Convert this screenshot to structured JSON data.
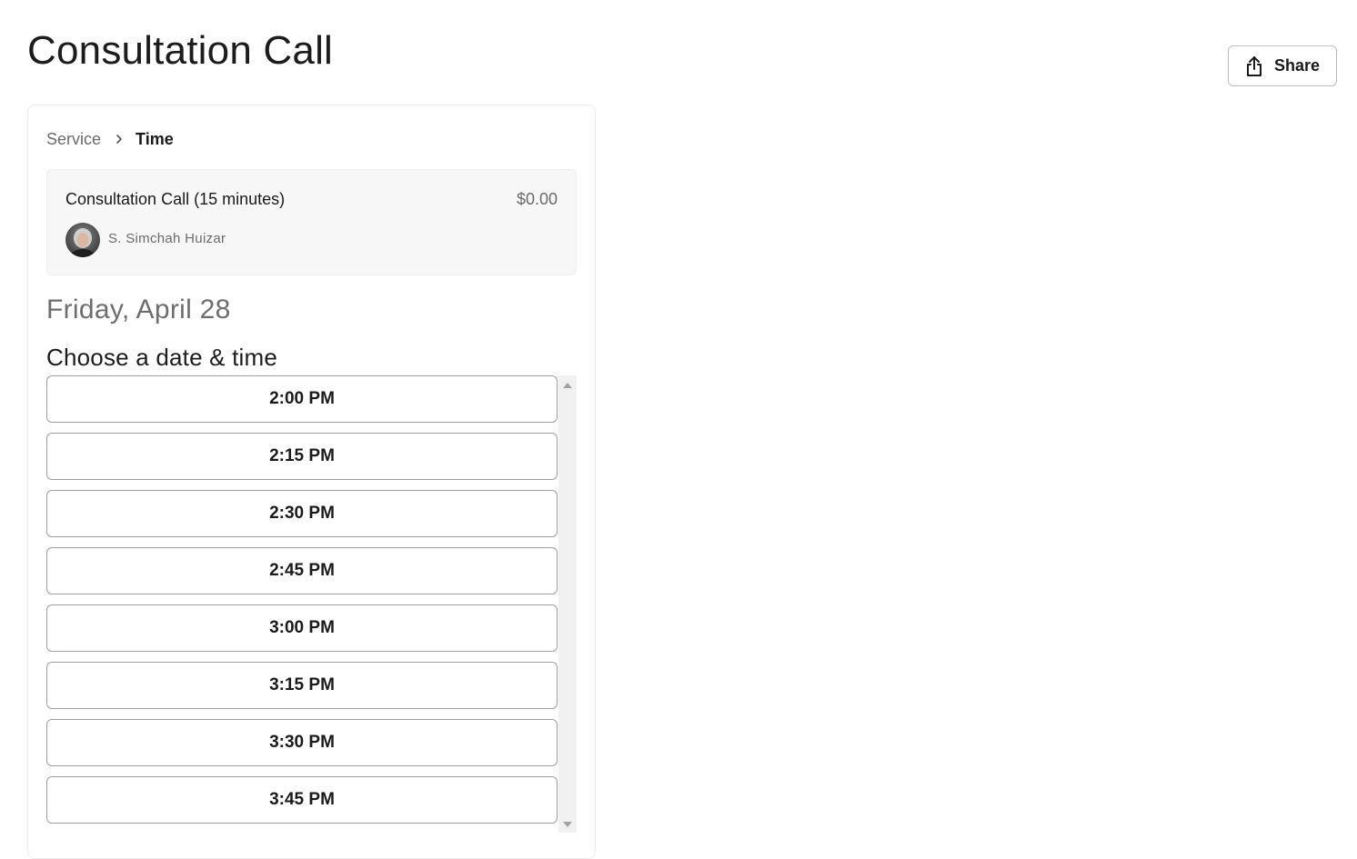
{
  "page": {
    "title": "Consultation Call"
  },
  "share": {
    "label": "Share",
    "icon": "share-icon"
  },
  "breadcrumb": {
    "items": [
      "Service",
      "Time"
    ],
    "separator_icon": "chevron-right-icon"
  },
  "service": {
    "name": "Consultation Call (15 minutes)",
    "price": "$0.00",
    "staff_name": "S. Simchah Huizar"
  },
  "booking": {
    "selected_date": "Friday, April 28",
    "heading": "Choose a date & time",
    "time_slots": [
      "2:00 PM",
      "2:15 PM",
      "2:30 PM",
      "2:45 PM",
      "3:00 PM",
      "3:15 PM",
      "3:30 PM",
      "3:45 PM"
    ]
  },
  "colors": {
    "text": "#1a1a1a",
    "muted": "#6b6b6b",
    "border": "#9e9e9e",
    "panel": "#f7f7f7"
  }
}
